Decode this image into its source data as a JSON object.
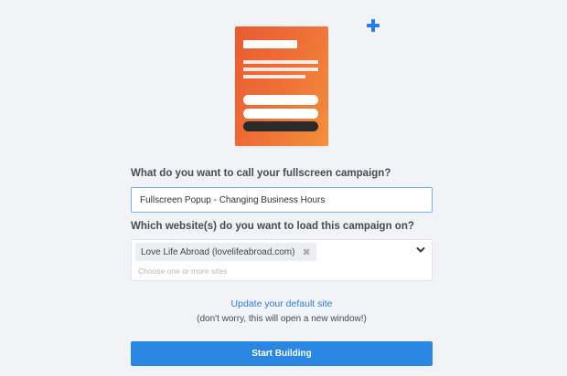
{
  "form": {
    "question_name": "What do you want to call your fullscreen campaign?",
    "campaign_name_value": "Fullscreen Popup - Changing Business Hours",
    "question_sites": "Which website(s) do you want to load this campaign on?",
    "selected_site": "Love Life Abroad (lovelifeabroad.com)",
    "remove_symbol": "✖",
    "sites_placeholder": "Choose one or more sites",
    "update_link": "Update your default site",
    "update_note": "(don't worry, this will open a new window!)",
    "start_button": "Start Building"
  },
  "icons": {
    "add": "plus-icon",
    "dropdown": "chevron-down-icon",
    "remove": "close-icon"
  },
  "colors": {
    "accent_blue": "#2a86e3",
    "link_blue": "#2e7fd6",
    "illustration_orange_start": "#ea5a32",
    "illustration_orange_end": "#f2903c",
    "background": "#f2f3f7"
  }
}
